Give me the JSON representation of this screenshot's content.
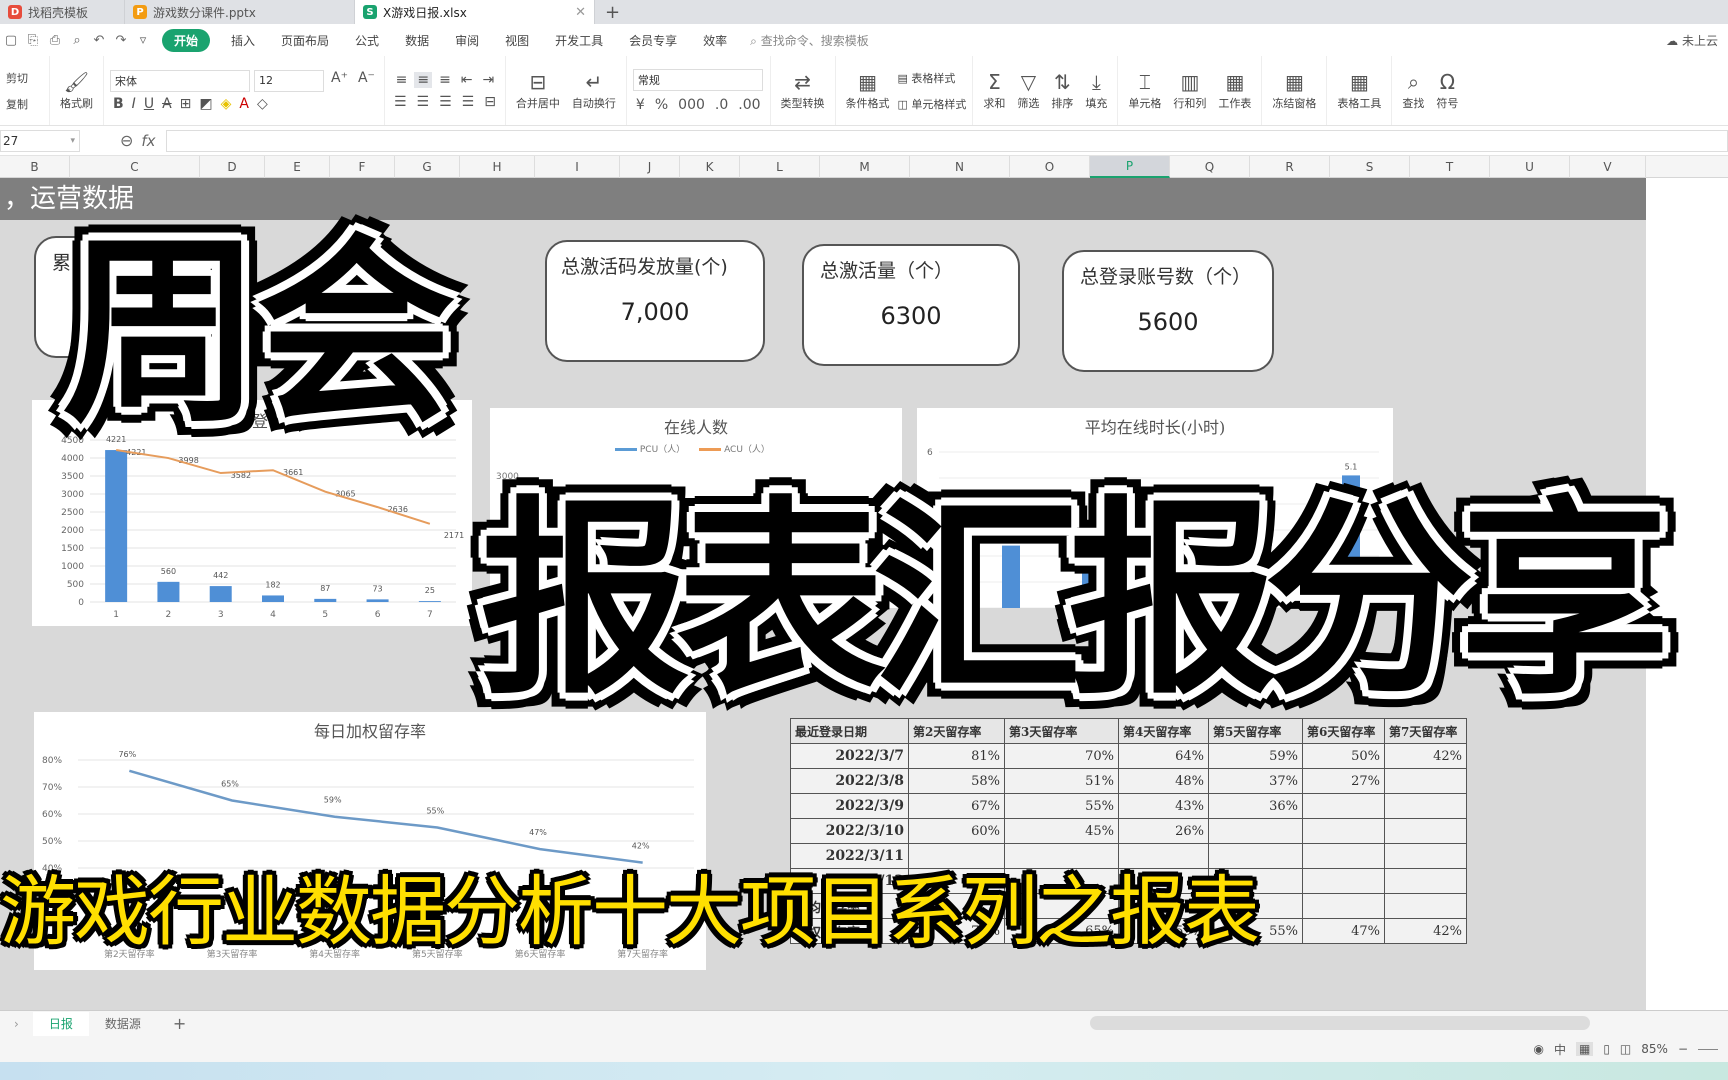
{
  "tabs": [
    {
      "icon": "wps-logo-icon",
      "label": "找稻壳模板",
      "color": "#e74c3c",
      "glyph": "D"
    },
    {
      "icon": "ppt-file-icon",
      "label": "游戏数分课件.pptx",
      "color": "#f39c12",
      "glyph": "P"
    },
    {
      "icon": "sheet-file-icon",
      "label": "X游戏日报.xlsx",
      "color": "#1aa36f",
      "glyph": "S",
      "active": true
    }
  ],
  "menu": {
    "items": [
      "开始",
      "插入",
      "页面布局",
      "公式",
      "数据",
      "审阅",
      "视图",
      "开发工具",
      "会员专享",
      "效率"
    ],
    "search_placeholder": "查找命令、搜索模板",
    "cloud_status": "未上云"
  },
  "ribbon": {
    "clipboard": {
      "cut": "剪切",
      "copy": "复制",
      "format_painter": "格式刷"
    },
    "font": {
      "name": "宋体",
      "size": "12"
    },
    "merge": "合并居中",
    "wrap": "自动换行",
    "number_format": "常规",
    "convert": "类型转换",
    "cond_format": "条件格式",
    "table_style": "表格样式",
    "cell_style": "单元格样式",
    "sum": "求和",
    "filter": "筛选",
    "sort": "排序",
    "fill": "填充",
    "cell": "单元格",
    "rowcol": "行和列",
    "worksheet": "工作表",
    "freeze": "冻结窗格",
    "table_tools": "表格工具",
    "find": "查找",
    "symbol": "符号"
  },
  "formula_bar": {
    "name_box": "27",
    "fx": "fx",
    "value": ""
  },
  "columns": [
    "B",
    "C",
    "D",
    "E",
    "F",
    "G",
    "H",
    "I",
    "J",
    "K",
    "L",
    "M",
    "N",
    "O",
    "P",
    "Q",
    "R",
    "S",
    "T",
    "U",
    "V"
  ],
  "selected_column": "P",
  "sheet": {
    "banner": "，运营数据",
    "cards": [
      {
        "label": "累",
        "value": ""
      },
      {
        "label": "总激活码发放量(个)",
        "value": "7,000"
      },
      {
        "label": "总激活量（个）",
        "value": "6300"
      },
      {
        "label": "总登录账号数（个）",
        "value": "5600"
      }
    ]
  },
  "chart_data": [
    {
      "type": "bar",
      "title": "每日新登…数",
      "categories": [
        "1",
        "2",
        "3",
        "4",
        "5",
        "6",
        "7"
      ],
      "series": [
        {
          "name": "bar",
          "type": "bar",
          "values": [
            4221,
            560,
            442,
            182,
            87,
            73,
            25
          ]
        },
        {
          "name": "line",
          "type": "line",
          "values": [
            4221,
            3998,
            3582,
            3661,
            3065,
            2636,
            2171
          ]
        }
      ],
      "yticks": [
        0,
        500,
        1000,
        1500,
        2000,
        2500,
        3000,
        3500,
        4000,
        4500
      ],
      "ylim": [
        0,
        4500
      ]
    },
    {
      "type": "line",
      "title": "在线人数",
      "legend": [
        "PCU（人）",
        "ACU（人）"
      ],
      "ylim": [
        0,
        3000
      ],
      "yticks": [
        3000
      ]
    },
    {
      "type": "bar",
      "title": "平均在线时长(小时)",
      "ylim": [
        0,
        6
      ],
      "visible_label": "5.1"
    },
    {
      "type": "line",
      "title": "每日加权留存率",
      "categories": [
        "第2天留存率",
        "第3天留存率",
        "第4天留存率",
        "第5天留存率",
        "第6天留存率",
        "第7天留存率"
      ],
      "values": [
        76,
        65,
        59,
        55,
        47,
        42
      ],
      "labels": [
        "76%",
        "65%",
        "59%",
        "55%",
        "47%",
        "42%"
      ],
      "yticks": [
        "40%",
        "50%",
        "60%",
        "70%",
        "80%"
      ],
      "ylim": [
        40,
        80
      ]
    }
  ],
  "retention_table": {
    "headers": [
      "最近登录日期",
      "第2天留存率",
      "第3天留存率",
      "第4天留存率",
      "第5天留存率",
      "第6天留存率",
      "第7天留存率"
    ],
    "rows": [
      [
        "2022/3/7",
        "81%",
        "70%",
        "64%",
        "59%",
        "50%",
        "42%"
      ],
      [
        "2022/3/8",
        "58%",
        "51%",
        "48%",
        "37%",
        "27%",
        ""
      ],
      [
        "2022/3/9",
        "67%",
        "55%",
        "43%",
        "36%",
        "",
        ""
      ],
      [
        "2022/3/10",
        "60%",
        "45%",
        "26%",
        "",
        "",
        ""
      ],
      [
        "2022/3/11",
        "",
        "",
        "",
        "",
        "",
        ""
      ],
      [
        "2022/3/12",
        "",
        "",
        "",
        "",
        "",
        ""
      ],
      [
        "平均留存率",
        "",
        "",
        "",
        "",
        "",
        ""
      ],
      [
        "加权留存率",
        "76%",
        "65%",
        "59%",
        "55%",
        "47%",
        "42%"
      ]
    ]
  },
  "overlay": {
    "title1": "周会",
    "title2": "报表汇报分享",
    "subtitle": "游戏行业数据分析十大项目系列之报表"
  },
  "sheet_tabs": [
    "日报",
    "数据源"
  ],
  "status": {
    "zoom": "85%"
  }
}
